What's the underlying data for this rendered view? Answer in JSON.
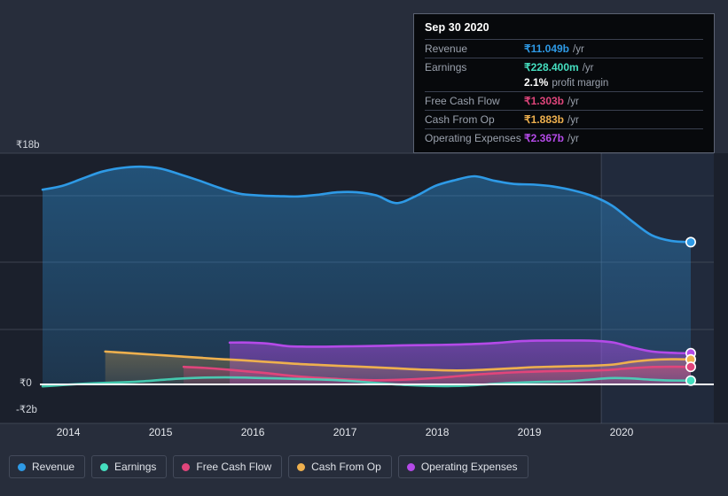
{
  "tooltip": {
    "title": "Sep 30 2020",
    "rows": [
      {
        "label": "Revenue",
        "value": "₹11.049b",
        "unit": "/yr",
        "color": "#2e9ae6"
      },
      {
        "label": "Earnings",
        "value": "₹228.400m",
        "unit": "/yr",
        "color": "#45dfc0"
      },
      {
        "label": "Free Cash Flow",
        "value": "₹1.303b",
        "unit": "/yr",
        "color": "#e0457b"
      },
      {
        "label": "Cash From Op",
        "value": "₹1.883b",
        "unit": "/yr",
        "color": "#eeb04e"
      },
      {
        "label": "Operating Expenses",
        "value": "₹2.367b",
        "unit": "/yr",
        "color": "#b martin"
      }
    ],
    "margin_value": "2.1%",
    "margin_label": "profit margin"
  },
  "legend": {
    "items": [
      {
        "label": "Revenue",
        "color": "#2e9ae6"
      },
      {
        "label": "Earnings",
        "color": "#45dfc0"
      },
      {
        "label": "Free Cash Flow",
        "color": "#e0457b"
      },
      {
        "label": "Cash From Op",
        "color": "#eeb04e"
      },
      {
        "label": "Operating Expenses",
        "color": "#b44ae8"
      }
    ]
  },
  "chart_data": {
    "type": "area",
    "title": "",
    "xlabel": "",
    "ylabel": "",
    "currency": "₹",
    "grid": true,
    "legend_position": "bottom",
    "ylim": [
      -2,
      18
    ],
    "yticks": [
      18,
      0,
      -2
    ],
    "ytick_labels": [
      "₹18b",
      "₹0",
      "-₹2b"
    ],
    "xticks": [
      2014,
      2015,
      2016,
      2017,
      2018,
      2019,
      2020
    ],
    "xtick_labels": [
      "2014",
      "2015",
      "2016",
      "2017",
      "2018",
      "2019",
      "2020"
    ],
    "forecast_start_x": 2019.78,
    "highlight_x": 2020.75,
    "series": [
      {
        "name": "Revenue",
        "color": "#2e9ae6",
        "last_value": 11.049,
        "values": [
          15.15,
          15.45,
          16.0,
          16.55,
          16.85,
          16.95,
          16.8,
          16.35,
          15.85,
          15.3,
          14.85,
          14.7,
          14.65,
          14.62,
          14.75,
          14.95,
          14.95,
          14.7,
          14.1,
          14.65,
          15.45,
          15.9,
          16.2,
          15.85,
          15.6,
          15.55,
          15.4,
          15.1,
          14.65,
          13.9,
          12.7,
          11.6,
          11.15,
          11.049
        ]
      },
      {
        "name": "Operating Expenses",
        "color": "#b44ae8",
        "last_value": 2.367,
        "start_x": 2015.75,
        "values": [
          3.2,
          3.2,
          3.12,
          2.92,
          2.88,
          2.88,
          2.9,
          2.92,
          2.95,
          2.98,
          3.0,
          3.02,
          3.05,
          3.1,
          3.18,
          3.3,
          3.35,
          3.36,
          3.36,
          3.34,
          3.2,
          2.8,
          2.5,
          2.4,
          2.367
        ]
      },
      {
        "name": "Cash From Op",
        "color": "#eeb04e",
        "last_value": 1.883,
        "start_x": 2014.4,
        "values": [
          2.5,
          2.4,
          2.3,
          2.2,
          2.1,
          2.0,
          1.9,
          1.82,
          1.72,
          1.62,
          1.52,
          1.45,
          1.38,
          1.32,
          1.25,
          1.18,
          1.1,
          1.05,
          1.02,
          1.05,
          1.12,
          1.2,
          1.28,
          1.32,
          1.36,
          1.4,
          1.48,
          1.7,
          1.85,
          1.9,
          1.883
        ]
      },
      {
        "name": "Free Cash Flow",
        "color": "#e0457b",
        "last_value": 1.303,
        "start_x": 2015.25,
        "values": [
          1.3,
          1.22,
          1.1,
          0.95,
          0.8,
          0.62,
          0.48,
          0.38,
          0.3,
          0.26,
          0.28,
          0.34,
          0.44,
          0.58,
          0.72,
          0.82,
          0.9,
          0.95,
          0.98,
          1.0,
          1.05,
          1.18,
          1.28,
          1.31,
          1.303
        ]
      },
      {
        "name": "Earnings",
        "color": "#45dfc0",
        "last_value": 0.2284,
        "values": [
          -0.22,
          -0.12,
          -0.02,
          0.05,
          0.1,
          0.18,
          0.3,
          0.4,
          0.46,
          0.48,
          0.46,
          0.42,
          0.38,
          0.34,
          0.3,
          0.22,
          0.1,
          -0.02,
          -0.12,
          -0.18,
          -0.2,
          -0.16,
          -0.06,
          0.04,
          0.1,
          0.14,
          0.18,
          0.3,
          0.42,
          0.4,
          0.3,
          0.24,
          0.2284
        ]
      }
    ]
  }
}
